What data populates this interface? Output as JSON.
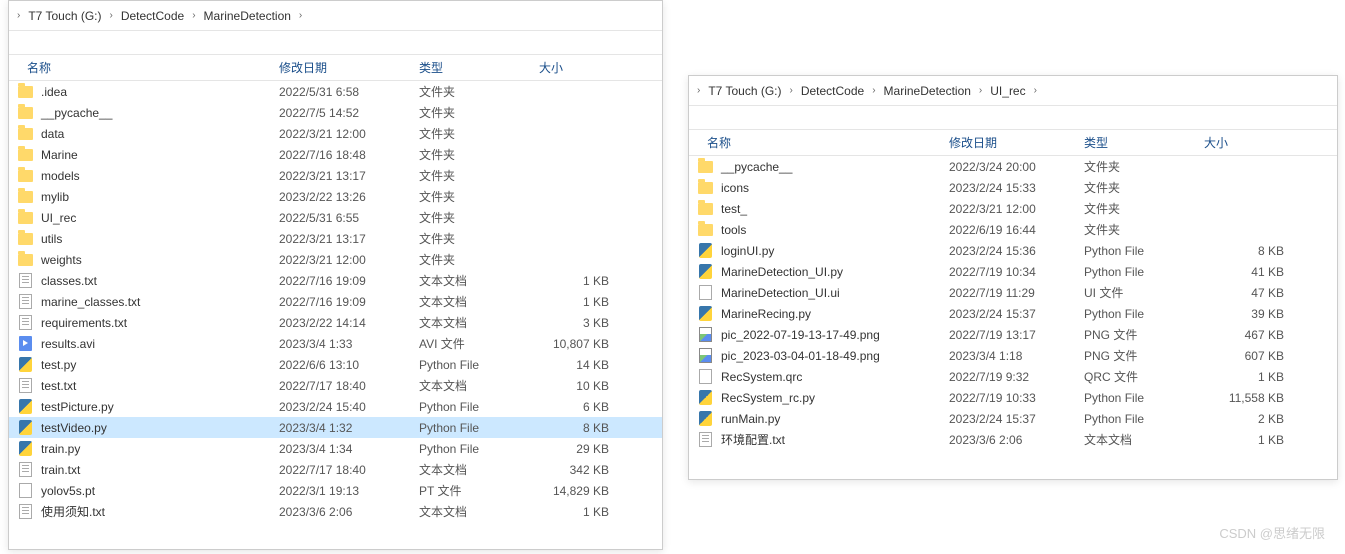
{
  "watermark": "CSDN @思绪无限",
  "left": {
    "breadcrumb": [
      "T7 Touch (G:)",
      "DetectCode",
      "MarineDetection"
    ],
    "columns": {
      "name": "名称",
      "date": "修改日期",
      "type": "类型",
      "size": "大小"
    },
    "rows": [
      {
        "icon": "folder",
        "name": ".idea",
        "date": "2022/5/31 6:58",
        "type": "文件夹",
        "size": ""
      },
      {
        "icon": "folder",
        "name": "__pycache__",
        "date": "2022/7/5 14:52",
        "type": "文件夹",
        "size": ""
      },
      {
        "icon": "folder",
        "name": "data",
        "date": "2022/3/21 12:00",
        "type": "文件夹",
        "size": ""
      },
      {
        "icon": "folder",
        "name": "Marine",
        "date": "2022/7/16 18:48",
        "type": "文件夹",
        "size": ""
      },
      {
        "icon": "folder",
        "name": "models",
        "date": "2022/3/21 13:17",
        "type": "文件夹",
        "size": ""
      },
      {
        "icon": "folder",
        "name": "mylib",
        "date": "2023/2/22 13:26",
        "type": "文件夹",
        "size": ""
      },
      {
        "icon": "folder",
        "name": "UI_rec",
        "date": "2022/5/31 6:55",
        "type": "文件夹",
        "size": ""
      },
      {
        "icon": "folder",
        "name": "utils",
        "date": "2022/3/21 13:17",
        "type": "文件夹",
        "size": ""
      },
      {
        "icon": "folder",
        "name": "weights",
        "date": "2022/3/21 12:00",
        "type": "文件夹",
        "size": ""
      },
      {
        "icon": "txt",
        "name": "classes.txt",
        "date": "2022/7/16 19:09",
        "type": "文本文档",
        "size": "1 KB"
      },
      {
        "icon": "txt",
        "name": "marine_classes.txt",
        "date": "2022/7/16 19:09",
        "type": "文本文档",
        "size": "1 KB"
      },
      {
        "icon": "txt",
        "name": "requirements.txt",
        "date": "2023/2/22 14:14",
        "type": "文本文档",
        "size": "3 KB"
      },
      {
        "icon": "avi",
        "name": "results.avi",
        "date": "2023/3/4 1:33",
        "type": "AVI 文件",
        "size": "10,807 KB"
      },
      {
        "icon": "py",
        "name": "test.py",
        "date": "2022/6/6 13:10",
        "type": "Python File",
        "size": "14 KB"
      },
      {
        "icon": "txt",
        "name": "test.txt",
        "date": "2022/7/17 18:40",
        "type": "文本文档",
        "size": "10 KB"
      },
      {
        "icon": "py",
        "name": "testPicture.py",
        "date": "2023/2/24 15:40",
        "type": "Python File",
        "size": "6 KB"
      },
      {
        "icon": "py",
        "name": "testVideo.py",
        "date": "2023/3/4 1:32",
        "type": "Python File",
        "size": "8 KB",
        "selected": true
      },
      {
        "icon": "py",
        "name": "train.py",
        "date": "2023/3/4 1:34",
        "type": "Python File",
        "size": "29 KB"
      },
      {
        "icon": "txt",
        "name": "train.txt",
        "date": "2022/7/17 18:40",
        "type": "文本文档",
        "size": "342 KB"
      },
      {
        "icon": "pt",
        "name": "yolov5s.pt",
        "date": "2022/3/1 19:13",
        "type": "PT 文件",
        "size": "14,829 KB"
      },
      {
        "icon": "txt",
        "name": "使用须知.txt",
        "date": "2023/3/6 2:06",
        "type": "文本文档",
        "size": "1 KB"
      }
    ]
  },
  "right": {
    "breadcrumb": [
      "T7 Touch (G:)",
      "DetectCode",
      "MarineDetection",
      "UI_rec"
    ],
    "columns": {
      "name": "名称",
      "date": "修改日期",
      "type": "类型",
      "size": "大小"
    },
    "rows": [
      {
        "icon": "folder",
        "name": "__pycache__",
        "date": "2022/3/24 20:00",
        "type": "文件夹",
        "size": ""
      },
      {
        "icon": "folder",
        "name": "icons",
        "date": "2023/2/24 15:33",
        "type": "文件夹",
        "size": ""
      },
      {
        "icon": "folder",
        "name": "test_",
        "date": "2022/3/21 12:00",
        "type": "文件夹",
        "size": ""
      },
      {
        "icon": "folder",
        "name": "tools",
        "date": "2022/6/19 16:44",
        "type": "文件夹",
        "size": ""
      },
      {
        "icon": "py",
        "name": "loginUI.py",
        "date": "2023/2/24 15:36",
        "type": "Python File",
        "size": "8 KB"
      },
      {
        "icon": "py",
        "name": "MarineDetection_UI.py",
        "date": "2022/7/19 10:34",
        "type": "Python File",
        "size": "41 KB"
      },
      {
        "icon": "ui",
        "name": "MarineDetection_UI.ui",
        "date": "2022/7/19 11:29",
        "type": "UI 文件",
        "size": "47 KB"
      },
      {
        "icon": "py",
        "name": "MarineRecing.py",
        "date": "2023/2/24 15:37",
        "type": "Python File",
        "size": "39 KB"
      },
      {
        "icon": "png",
        "name": "pic_2022-07-19-13-17-49.png",
        "date": "2022/7/19 13:17",
        "type": "PNG 文件",
        "size": "467 KB"
      },
      {
        "icon": "png",
        "name": "pic_2023-03-04-01-18-49.png",
        "date": "2023/3/4 1:18",
        "type": "PNG 文件",
        "size": "607 KB"
      },
      {
        "icon": "qrc",
        "name": "RecSystem.qrc",
        "date": "2022/7/19 9:32",
        "type": "QRC 文件",
        "size": "1 KB"
      },
      {
        "icon": "py",
        "name": "RecSystem_rc.py",
        "date": "2022/7/19 10:33",
        "type": "Python File",
        "size": "11,558 KB"
      },
      {
        "icon": "py",
        "name": "runMain.py",
        "date": "2023/2/24 15:37",
        "type": "Python File",
        "size": "2 KB"
      },
      {
        "icon": "txt",
        "name": "环境配置.txt",
        "date": "2023/3/6 2:06",
        "type": "文本文档",
        "size": "1 KB"
      }
    ]
  }
}
